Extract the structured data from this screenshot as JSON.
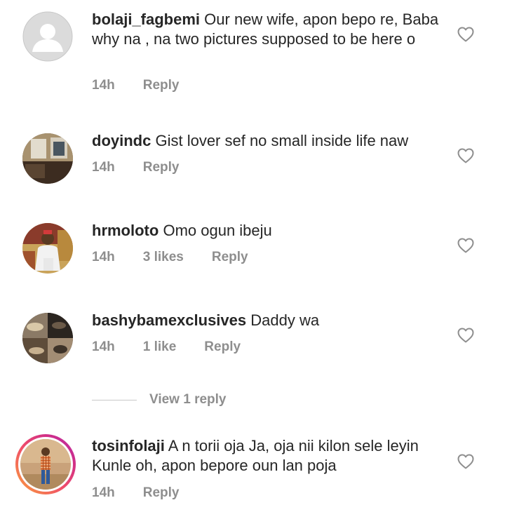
{
  "comments": [
    {
      "username": "bolaji_fagbemi",
      "text": "Our new wife, apon bepo re, Baba why na , na two pictures supposed to be here o",
      "time": "14h",
      "likes": "",
      "reply_label": "Reply",
      "avatar_icon": "default-profile-icon"
    },
    {
      "username": "doyindc",
      "text": "Gist lover sef no small inside life naw",
      "time": "14h",
      "likes": "",
      "reply_label": "Reply",
      "avatar_icon": "profile-photo"
    },
    {
      "username": "hrmoloto",
      "text": "Omo ogun ibeju",
      "time": "14h",
      "likes": "3 likes",
      "reply_label": "Reply",
      "avatar_icon": "profile-photo"
    },
    {
      "username": "bashybamexclusives",
      "text": "Daddy wa",
      "time": "14h",
      "likes": "1 like",
      "reply_label": "Reply",
      "avatar_icon": "profile-photo"
    },
    {
      "username": "tosinfolaji",
      "text": "A n torii oja Ja, oja nii kilon sele leyin Kunle oh, apon bepore oun lan poja",
      "time": "14h",
      "likes": "",
      "reply_label": "Reply",
      "avatar_icon": "profile-photo-story-ring"
    }
  ],
  "view_replies_label": "View 1 reply",
  "colors": {
    "text": "#262626",
    "meta": "#8e8e8e",
    "divider": "#c7c7c7",
    "heart_stroke": "#8e8e8e"
  }
}
